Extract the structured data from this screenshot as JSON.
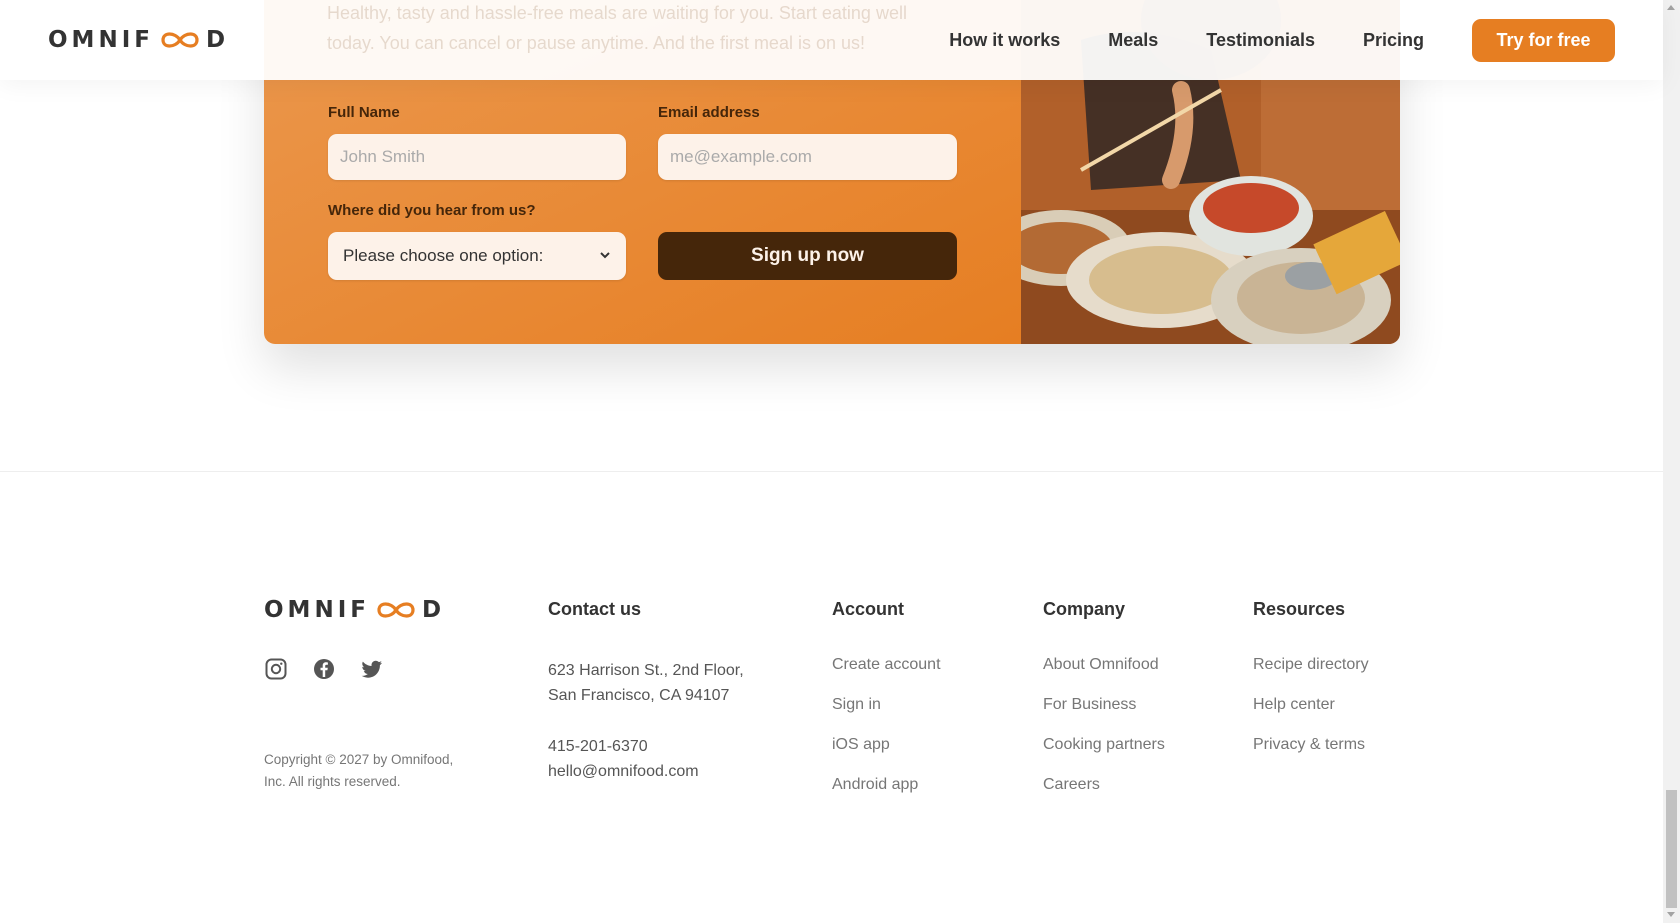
{
  "header": {
    "logo_left": "OMNIF",
    "logo_right": "D",
    "ghost_text": "Healthy, tasty and hassle-free meals are waiting for you. Start eating well today. You can cancel or pause anytime. And the first meal is on us!",
    "nav": [
      {
        "label": "How it works"
      },
      {
        "label": "Meals"
      },
      {
        "label": "Testimonials"
      },
      {
        "label": "Pricing"
      }
    ],
    "cta_label": "Try for free"
  },
  "signup_form": {
    "full_name_label": "Full Name",
    "full_name_placeholder": "John Smith",
    "email_label": "Email address",
    "email_placeholder": "me@example.com",
    "source_label": "Where did you hear from us?",
    "source_selected": "Please choose one option:",
    "submit_label": "Sign up now"
  },
  "footer": {
    "logo_left": "OMNIF",
    "logo_right": "D",
    "social_icons": [
      "instagram-icon",
      "facebook-icon",
      "twitter-icon"
    ],
    "copyright_line1": "Copyright © 2027 by Omnifood,",
    "copyright_line2": "Inc. All rights reserved.",
    "contact": {
      "title": "Contact us",
      "address_line1": "623 Harrison St., 2nd Floor,",
      "address_line2": "San Francisco, CA 94107",
      "phone": "415-201-6370",
      "email": "hello@omnifood.com"
    },
    "account": {
      "title": "Account",
      "links": [
        "Create account",
        "Sign in",
        "iOS app",
        "Android app"
      ]
    },
    "company": {
      "title": "Company",
      "links": [
        "About Omnifood",
        "For Business",
        "Cooking partners",
        "Careers"
      ]
    },
    "resources": {
      "title": "Resources",
      "links": [
        "Recipe directory",
        "Help center",
        "Privacy & terms"
      ]
    }
  },
  "colors": {
    "primary": "#e67e22",
    "primary_dark": "#45260a",
    "input_bg": "#fdf2e9",
    "text": "#333333",
    "muted": "#767676"
  }
}
